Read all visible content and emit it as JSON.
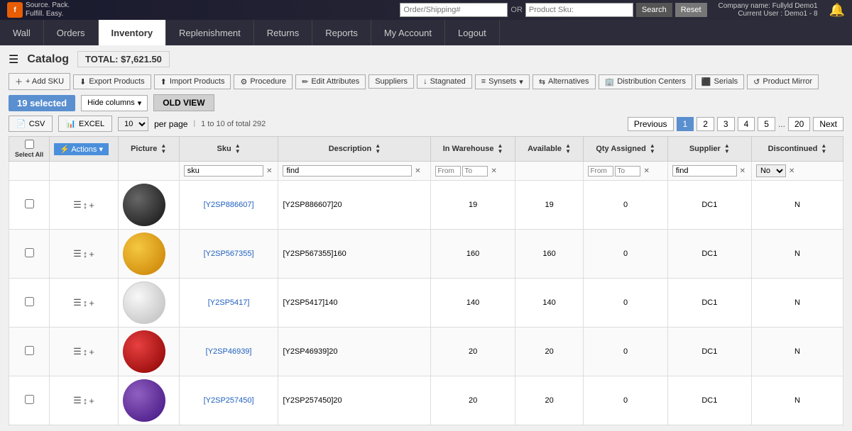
{
  "app": {
    "name": "fullfyld",
    "tagline": "Source.\nPack.\nFulfill.\nEasy."
  },
  "topbar": {
    "search_placeholder1": "Order/Shipping#",
    "search_or": "OR",
    "search_placeholder2": "Product Sku:",
    "btn_search": "Search",
    "btn_reset": "Reset",
    "company_name": "Company name: Fullyld Demo1",
    "current_user": "Current User : Demo1 - 8"
  },
  "nav": {
    "items": [
      {
        "id": "wall",
        "label": "Wall",
        "active": false
      },
      {
        "id": "orders",
        "label": "Orders",
        "active": false
      },
      {
        "id": "inventory",
        "label": "Inventory",
        "active": true
      },
      {
        "id": "replenishment",
        "label": "Replenishment",
        "active": false
      },
      {
        "id": "returns",
        "label": "Returns",
        "active": false
      },
      {
        "id": "reports",
        "label": "Reports",
        "active": false
      },
      {
        "id": "my_account",
        "label": "My Account",
        "active": false
      },
      {
        "id": "logout",
        "label": "Logout",
        "active": false
      }
    ]
  },
  "catalog": {
    "title": "Catalog",
    "total_label": "TOTAL: $7,621.50",
    "toolbar": {
      "add_sku": "+ Add SKU",
      "export_products": "Export Products",
      "import_products": "Import Products",
      "procedure": "Procedure",
      "edit_attributes": "Edit Attributes",
      "suppliers": "Suppliers",
      "stagnated": "Stagnated",
      "synsets": "Synsets",
      "alternatives": "Alternatives",
      "distribution_centers": "Distribution Centers",
      "serials": "Serials",
      "product_mirror": "Product Mirror"
    },
    "selected_count": "19 selected",
    "hide_columns": "Hide columns",
    "old_view": "OLD VIEW",
    "btn_csv": "CSV",
    "btn_excel": "EXCEL",
    "per_page": "10",
    "per_page_label": "per page",
    "page_info": "1 to 10 of total 292",
    "pagination": {
      "previous": "Previous",
      "pages": [
        "1",
        "2",
        "3",
        "4",
        "5",
        "..."
      ],
      "last": "20",
      "next": "Next",
      "current": "1"
    }
  },
  "table": {
    "columns": [
      {
        "id": "checkbox",
        "label": ""
      },
      {
        "id": "actions",
        "label": ""
      },
      {
        "id": "picture",
        "label": "Picture"
      },
      {
        "id": "sku",
        "label": "Sku"
      },
      {
        "id": "description",
        "label": "Description"
      },
      {
        "id": "in_warehouse",
        "label": "In Warehouse"
      },
      {
        "id": "available",
        "label": "Available"
      },
      {
        "id": "qty_assigned",
        "label": "Qty Assigned"
      },
      {
        "id": "supplier",
        "label": "Supplier"
      },
      {
        "id": "discontinued",
        "label": "Discontinued"
      }
    ],
    "filters": {
      "sku_value": "sku",
      "description_value": "find",
      "in_warehouse_from": "From",
      "in_warehouse_to": "To",
      "qty_assigned_from": "From",
      "qty_assigned_to": "To",
      "supplier_value": "find",
      "discontinued_value": "No"
    },
    "rows": [
      {
        "id": 1,
        "sku": "[Y2SP886607]",
        "description": "[Y2SP886607]20",
        "in_warehouse": "19",
        "available": "19",
        "qty_assigned": "0",
        "supplier": "DC1",
        "discontinued": "N",
        "img_color": "black"
      },
      {
        "id": 2,
        "sku": "[Y2SP567355]",
        "description": "[Y2SP567355]160",
        "in_warehouse": "160",
        "available": "160",
        "qty_assigned": "0",
        "supplier": "DC1",
        "discontinued": "N",
        "img_color": "yellow"
      },
      {
        "id": 3,
        "sku": "[Y2SP5417]",
        "description": "[Y2SP5417]140",
        "in_warehouse": "140",
        "available": "140",
        "qty_assigned": "0",
        "supplier": "DC1",
        "discontinued": "N",
        "img_color": "white"
      },
      {
        "id": 4,
        "sku": "[Y2SP46939]",
        "description": "[Y2SP46939]20",
        "in_warehouse": "20",
        "available": "20",
        "qty_assigned": "0",
        "supplier": "DC1",
        "discontinued": "N",
        "img_color": "red"
      },
      {
        "id": 5,
        "sku": "[Y2SP257450]",
        "description": "[Y2SP257450]20",
        "in_warehouse": "20",
        "available": "20",
        "qty_assigned": "0",
        "supplier": "DC1",
        "discontinued": "N",
        "img_color": "purple"
      }
    ]
  }
}
